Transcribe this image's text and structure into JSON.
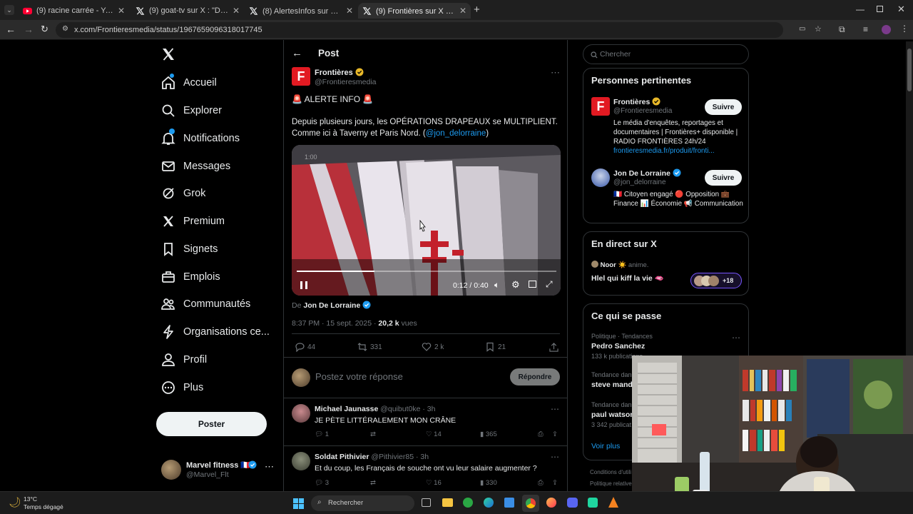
{
  "browser": {
    "tabs": [
      {
        "title": "(9) racine carrée - YouTube",
        "icon": "youtube-icon"
      },
      {
        "title": "(9) goat-tv sur X : \"Dinguerie ! l",
        "icon": "x-logo-icon"
      },
      {
        "title": "(8) AlertesInfos sur X : \"🚨🇮🇳 IN",
        "icon": "x-logo-icon"
      },
      {
        "title": "(9) Frontières sur X : \"🚨 ALE",
        "icon": "x-logo-icon"
      }
    ],
    "url": "x.com/Frontieresmedia/status/1967659096318017745"
  },
  "nav": {
    "items": [
      "Accueil",
      "Explorer",
      "Notifications",
      "Messages",
      "Grok",
      "Premium",
      "Signets",
      "Emplois",
      "Communautés",
      "Organisations ce...",
      "Profil",
      "Plus"
    ],
    "post_button": "Poster",
    "account": {
      "name": "Marvel fitness 🇫🇷",
      "handle": "@Marvel_Flt"
    }
  },
  "post": {
    "header": "Post",
    "author_name": "Frontières",
    "author_handle": "@Frontieresmedia",
    "avatar_letter": "F",
    "line1": "🚨 ALERTE INFO 🚨",
    "body": "Depuis plusieurs jours, les OPÉRATIONS DRAPEAUX se MULTIPLIENT. Comme ici à Taverny et Paris Nord. (",
    "mention": "@jon_delorraine",
    "body_end": ")",
    "video": {
      "overlay_time": "1:00",
      "time": "0:12 / 0:40",
      "progress": 0.3
    },
    "from_label": "De",
    "from_name": "Jon De Lorraine",
    "timestamp": "8:37 PM · 15 sept. 2025 · ",
    "views": "20,2 k",
    "views_label": "vues",
    "stats": {
      "replies": "44",
      "reposts": "331",
      "likes": "2 k",
      "bookmarks": "21"
    },
    "reply_placeholder": "Postez votre réponse",
    "reply_button": "Répondre"
  },
  "replies": [
    {
      "name": "Michael Jaunasse",
      "handle": "@quibut0ke · 3h",
      "text": "JE PÈTE LITTÉRALEMENT MON CRÂNE",
      "replies": "1",
      "likes": "14",
      "views": "365"
    },
    {
      "name": "Soldat Pithivier",
      "handle": "@Pithivier85 · 3h",
      "text": "Et du coup, les Français de souche ont vu leur salaire augmenter ?",
      "replies": "3",
      "likes": "16",
      "views": "330"
    }
  ],
  "search": {
    "placeholder": "Chercher"
  },
  "relevant": {
    "title": "Personnes pertinentes",
    "follow_label": "Suivre",
    "people": [
      {
        "name": "Frontières",
        "handle": "@Frontieresmedia",
        "bio": "Le média d'enquêtes, reportages et documentaires | Frontières+ disponible | RADIO FRONTIÈRES 24h/24",
        "link": "frontieresmedia.fr/produit/fronti..."
      },
      {
        "name": "Jon De Lorraine",
        "handle": "@jon_delorraine",
        "bio": "🇫🇷 Citoyen engagé 🔴 Opposition 💼 Finance 📊 Économie 📢 Communication",
        "link": ""
      }
    ]
  },
  "live": {
    "title": "En direct sur X",
    "host": "Noor ☀️",
    "host_suffix": "anime.",
    "space_title": "Hlel qui kiff la vie 🫦",
    "listeners": "+18"
  },
  "trends": {
    "title": "Ce qui se passe",
    "items": [
      {
        "context": "Politique · Tendances",
        "name": "Pedro Sanchez",
        "count": "133 k publications"
      },
      {
        "context": "Tendance dans",
        "name": "steve manda",
        "count": ""
      },
      {
        "context": "Tendance dans",
        "name": "paul watson",
        "count": "3 342 publicat"
      }
    ],
    "see_more": "Voir plus"
  },
  "footer_links": [
    "Conditions d'utili",
    "Politique relative"
  ],
  "taskbar": {
    "temp": "13°C",
    "weather": "Temps dégagé",
    "search": "Rechercher"
  }
}
